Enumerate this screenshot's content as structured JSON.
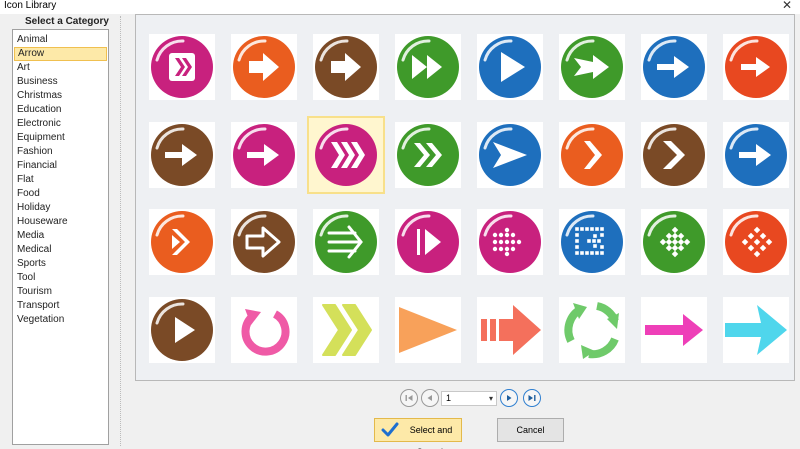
{
  "window": {
    "title": "Icon Library",
    "close_glyph": "✕"
  },
  "sidebar": {
    "header": "Select a Category",
    "selected_index": 1,
    "items": [
      "Animal",
      "Arrow",
      "Art",
      "Business",
      "Christmas",
      "Education",
      "Electronic",
      "Equipment",
      "Fashion",
      "Financial",
      "Flat",
      "Food",
      "Holiday",
      "Houseware",
      "Media",
      "Medical",
      "Sports",
      "Tool",
      "Tourism",
      "Transport",
      "Vegetation"
    ]
  },
  "icons": [
    {
      "name": "double-chevron-box-magenta-icon",
      "color": "#c8217e"
    },
    {
      "name": "block-arrow-orange-icon",
      "color": "#ea5d1f"
    },
    {
      "name": "block-arrow-brown-icon",
      "color": "#7a4a26"
    },
    {
      "name": "fast-forward-green-icon",
      "color": "#3f9a2a"
    },
    {
      "name": "play-triangle-blue-icon",
      "color": "#1e6fbd"
    },
    {
      "name": "wide-arrow-green-icon",
      "color": "#3f9a2a"
    },
    {
      "name": "arrow-right-blue-icon",
      "color": "#1e6fbd"
    },
    {
      "name": "arrow-right-red-orange-icon",
      "color": "#e84820"
    },
    {
      "name": "arrow-right-brown-icon",
      "color": "#7a4a26"
    },
    {
      "name": "arrow-right-magenta-icon",
      "color": "#c8217e"
    },
    {
      "name": "triple-chevron-magenta-icon",
      "color": "#c8217e"
    },
    {
      "name": "double-chevron-green-icon",
      "color": "#3f9a2a"
    },
    {
      "name": "send-arrow-blue-icon",
      "color": "#1e6fbd"
    },
    {
      "name": "chevron-right-orange-icon",
      "color": "#ea5d1f"
    },
    {
      "name": "chevron-right-brown-icon",
      "color": "#7a4a26"
    },
    {
      "name": "arrow-right-blue-2-icon",
      "color": "#1e6fbd"
    },
    {
      "name": "chevron-play-orange-icon",
      "color": "#ea5d1f"
    },
    {
      "name": "outline-arrow-brown-icon",
      "color": "#7a4a26"
    },
    {
      "name": "multi-line-arrow-green-icon",
      "color": "#3f9a2a"
    },
    {
      "name": "play-line-magenta-icon",
      "color": "#c8217e"
    },
    {
      "name": "dotted-arrow-magenta-icon",
      "color": "#c8217e"
    },
    {
      "name": "dotted-box-arrow-blue-icon",
      "color": "#1e6fbd"
    },
    {
      "name": "dotted-arrow-green-icon",
      "color": "#3f9a2a"
    },
    {
      "name": "dotted-arrow-red-icon",
      "color": "#e84820"
    },
    {
      "name": "play-triangle-brown-icon",
      "color": "#7a4a26"
    },
    {
      "name": "circular-refresh-pink-icon",
      "color": "#ef5aa6"
    },
    {
      "name": "double-chevron-lime-icon",
      "color": "#d4e05a"
    },
    {
      "name": "flat-triangle-orange-icon",
      "color": "#f8a15a"
    },
    {
      "name": "striped-arrow-coral-icon",
      "color": "#f4705c"
    },
    {
      "name": "cycle-arrows-green-icon",
      "color": "#6fca6a"
    },
    {
      "name": "flat-arrow-magenta-icon",
      "color": "#ee3fb8"
    },
    {
      "name": "flat-arrow-cyan-icon",
      "color": "#4fd6ec"
    }
  ],
  "selected_icon_index": 10,
  "pager": {
    "page": "1",
    "caret": "▾"
  },
  "buttons": {
    "select_open": "Select and Open It",
    "cancel": "Cancel"
  }
}
